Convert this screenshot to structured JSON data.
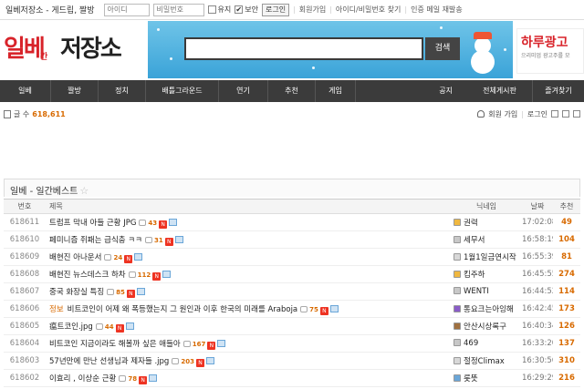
{
  "topbar": {
    "site_title": "일베저장소 - 게드립, 짤방",
    "id_placeholder": "아이디",
    "pw_placeholder": "비밀번호",
    "keep_label": "유지",
    "secure_label": "보안",
    "login_label": "로그인",
    "links": [
      "회원가입",
      "아이디/비밀번호 찾기",
      "인증 메일 재발송"
    ]
  },
  "header": {
    "logo_main": "일베",
    "logo_sub": "간",
    "logo_tail": "저장소",
    "search_button": "검색",
    "ad_title": "하루광고",
    "ad_sub": "으리미엄 광고주를 모"
  },
  "nav": {
    "items": [
      "일베",
      "짤방",
      "정치",
      "배틀그라운드",
      "연기",
      "추천",
      "게임",
      "공지",
      "전체게시판",
      "즐겨찾기"
    ]
  },
  "stats": {
    "label": "글 수",
    "count": "618,611",
    "signup": "회원 가입",
    "login": "로그인"
  },
  "board": {
    "title": "일베 - 일간베스트",
    "star": "☆",
    "columns": [
      "번호",
      "제목",
      "닉네임",
      "날짜",
      "추천"
    ],
    "rows": [
      {
        "num": "618611",
        "category": "",
        "subject": "트럼프 막내 아들 근황 JPG",
        "comments": "43",
        "nick": "권력",
        "date": "17:02:08",
        "rec": "49"
      },
      {
        "num": "618610",
        "category": "",
        "subject": "페미니즘 쥐패는 급식충 ㅋㅋ",
        "comments": "31",
        "nick": "세무서",
        "date": "16:58:19",
        "rec": "104"
      },
      {
        "num": "618609",
        "category": "",
        "subject": "배현진 아나운서",
        "comments": "24",
        "nick": "1월1일금연시작",
        "date": "16:55:39",
        "rec": "81"
      },
      {
        "num": "618608",
        "category": "",
        "subject": "배현진 뉴스데스크 하차",
        "comments": "112",
        "nick": "킴주하",
        "date": "16:45:55",
        "rec": "274"
      },
      {
        "num": "618607",
        "category": "",
        "subject": "중국 화장실 특징",
        "comments": "85",
        "nick": "WENTI",
        "date": "16:44:52",
        "rec": "114"
      },
      {
        "num": "618606",
        "category": "정보",
        "subject": "비트코인이 어제 왜 폭등했는지 그 원인과 이후 한국의 미래를 Araboja",
        "comments": "75",
        "nick": "통요크는아잉해",
        "date": "16:42:45",
        "rec": "173"
      },
      {
        "num": "618605",
        "category": "",
        "subject": "瘟트코인.jpg",
        "comments": "44",
        "nick": "안산시상록구",
        "date": "16:40:34",
        "rec": "126"
      },
      {
        "num": "618604",
        "category": "",
        "subject": "비트코인 지금이라도 해볼까 싶은 애들아",
        "comments": "167",
        "nick": "469",
        "date": "16:33:20",
        "rec": "137"
      },
      {
        "num": "618603",
        "category": "",
        "subject": "57년만에 만난 선생님과 제자들 .jpg",
        "comments": "203",
        "nick": "절정Climax",
        "date": "16:30:56",
        "rec": "310"
      },
      {
        "num": "618602",
        "category": "",
        "subject": "이효리 , 이상순 근황",
        "comments": "78",
        "nick": "롯뜻",
        "date": "16:29:29",
        "rec": "216"
      }
    ]
  }
}
